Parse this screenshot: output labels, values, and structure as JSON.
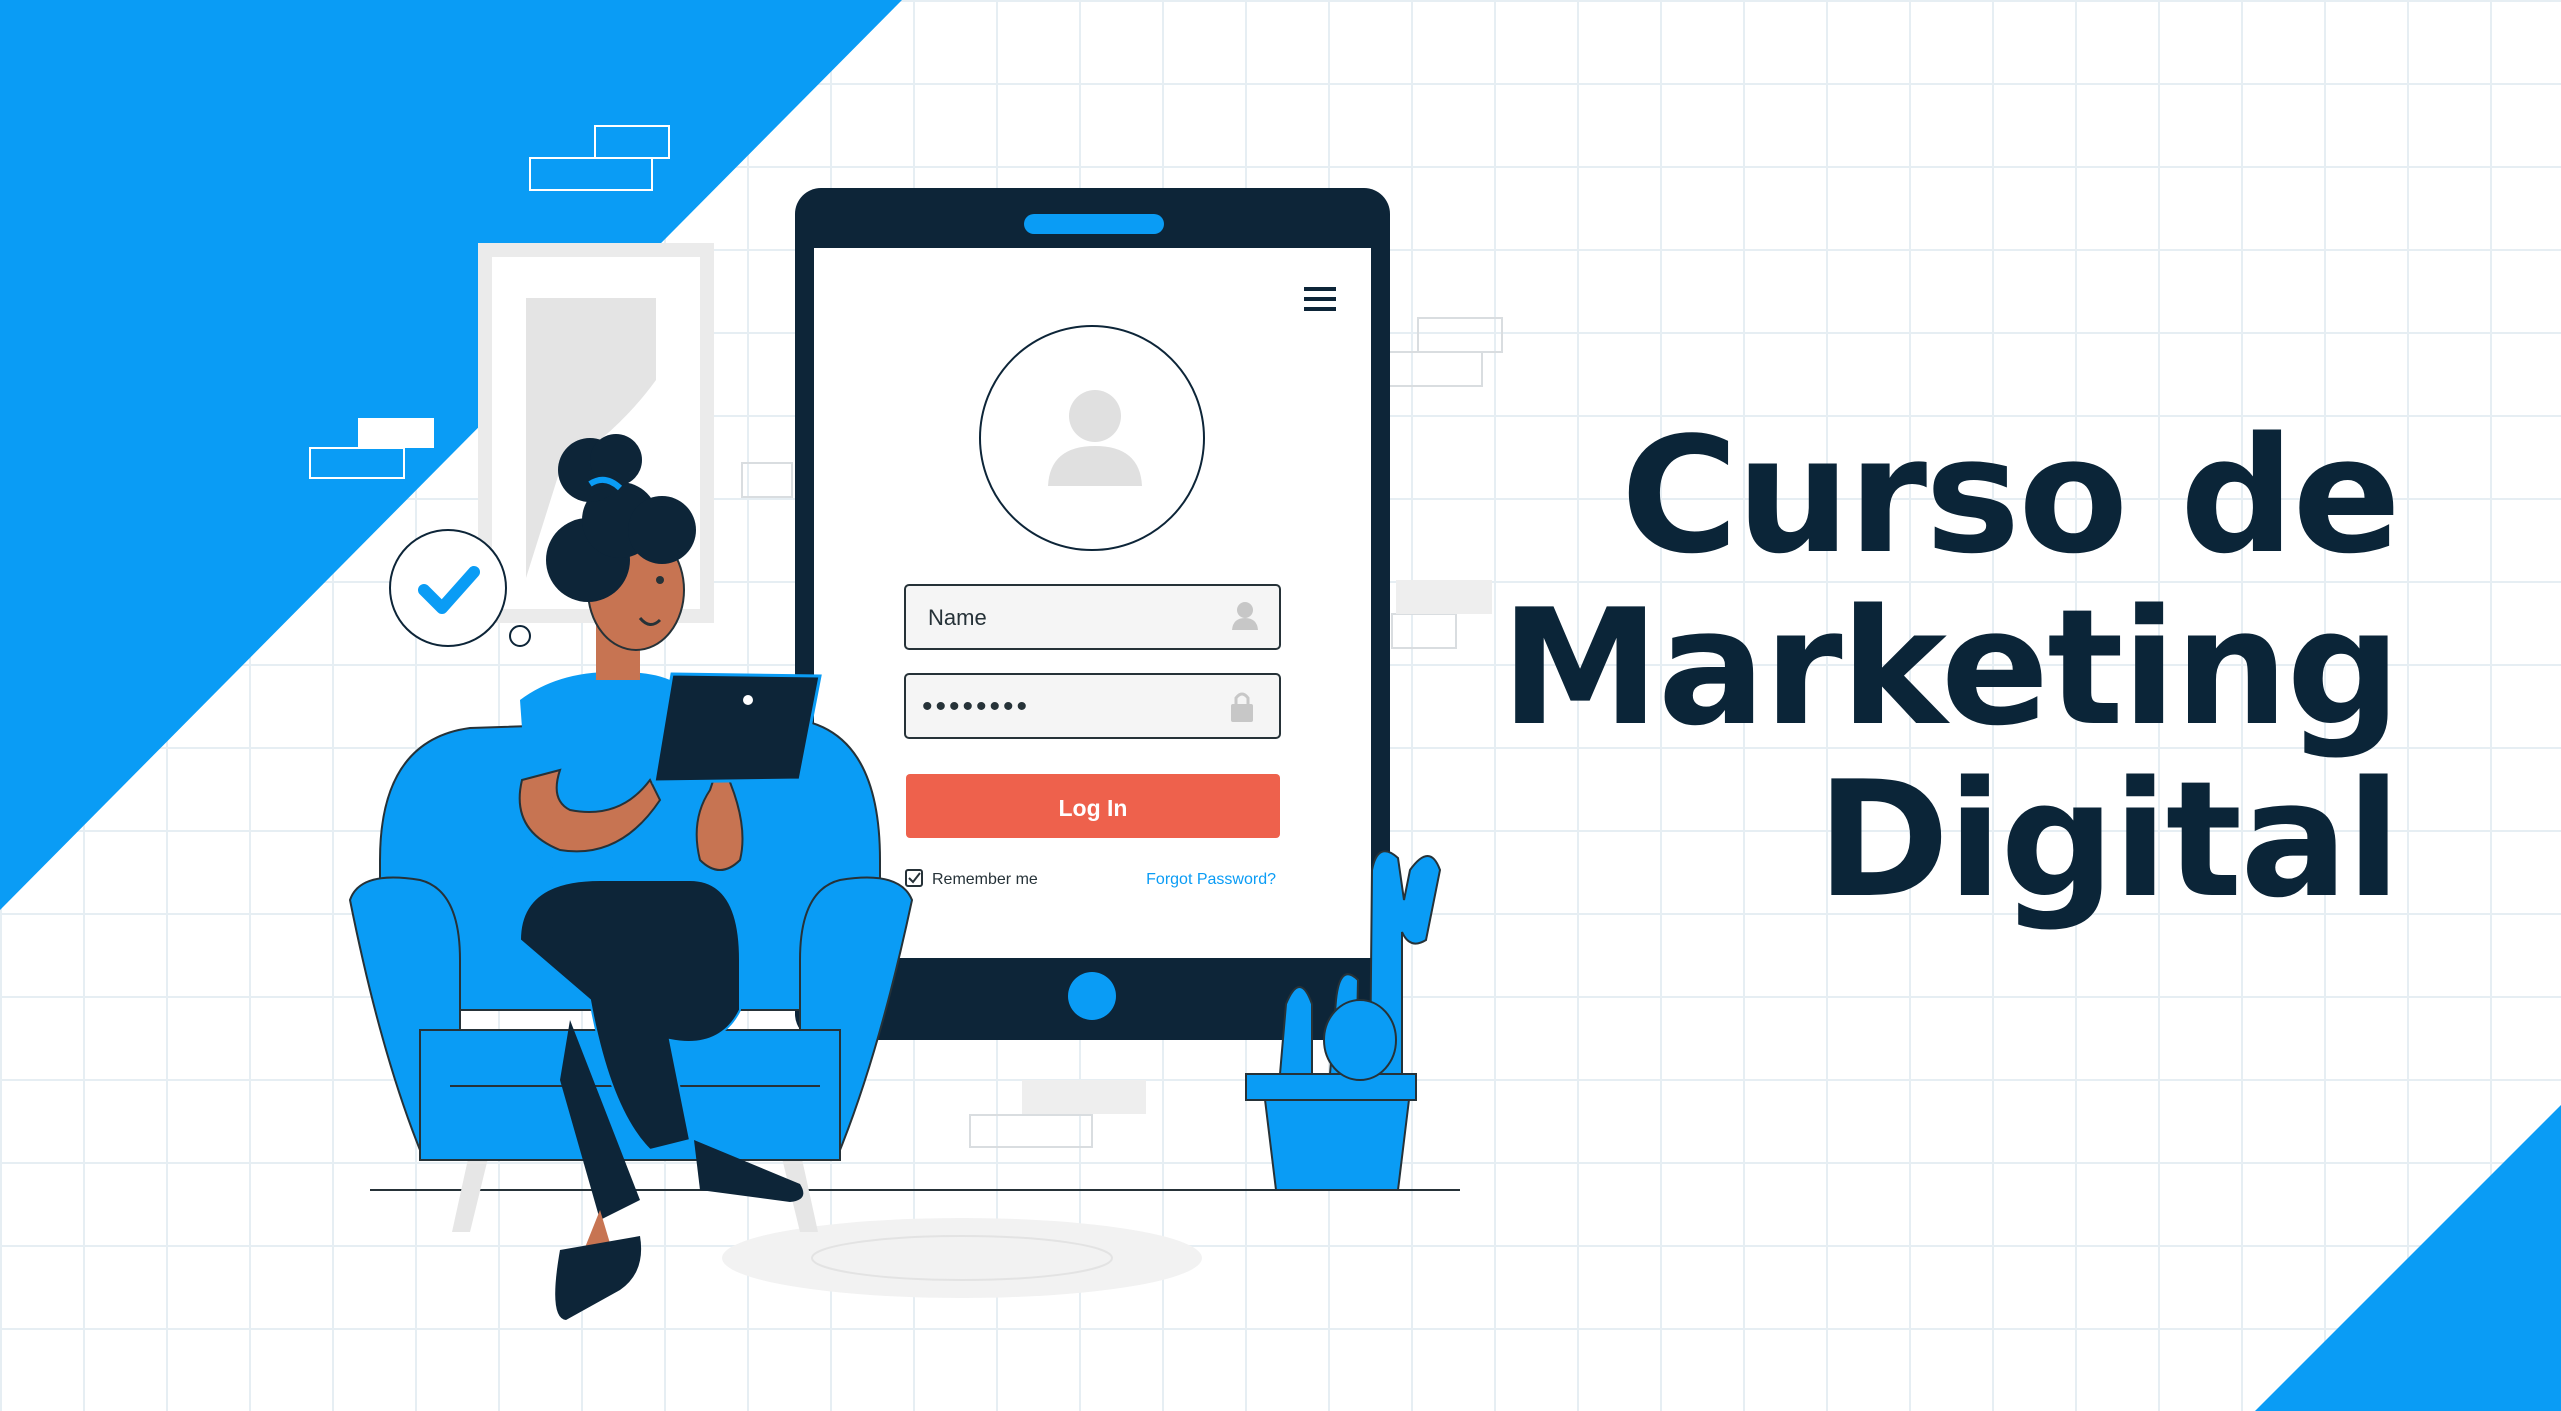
{
  "headline": {
    "line1": "Curso de",
    "line2": "Marketing",
    "line3": "Digital"
  },
  "login": {
    "name_field": "Name",
    "password_field": "••••••••",
    "login_button": "Log In",
    "remember_me": "Remember me",
    "remember_checked": true,
    "forgot_password": "Forgot Password?"
  },
  "colors": {
    "brand_blue": "#0a9cf5",
    "navy": "#0d2538",
    "login_button": "#ee614c",
    "link_blue": "#0a9cf5"
  },
  "icons": {
    "menu": "hamburger-menu-icon",
    "avatar": "user-avatar-icon",
    "name": "user-icon",
    "password": "lock-icon",
    "check": "checkmark-icon"
  }
}
